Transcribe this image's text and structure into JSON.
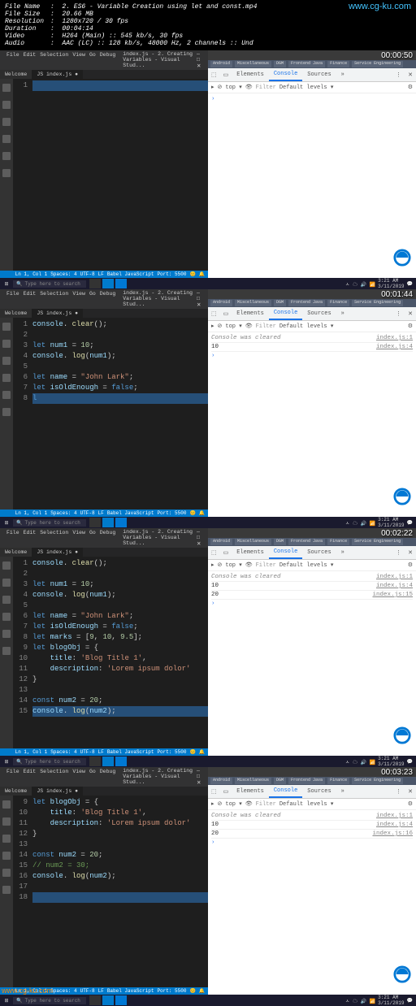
{
  "header": {
    "fileName": "2. ES6 - Variable Creation using let and const.mp4",
    "fileSize": "20.66 MB",
    "resolution": "1280x720 / 30 fps",
    "duration": "00:04:14",
    "video": "H264 (Main) :: 545 kb/s, 30 fps",
    "audio": "AAC (LC) :: 128 kb/s, 48000 Hz, 2 channels :: Und",
    "watermark": "www.cg-ku.com"
  },
  "vscode": {
    "menus": [
      "File",
      "Edit",
      "Selection",
      "View",
      "Go",
      "Debug"
    ],
    "title": "index.js - 2. Creating Variables - Visual Stud...",
    "tab_inactive": "Welcome",
    "tab_active": "index.js",
    "status": {
      "ln": "Ln 1, Col 1",
      "spaces": "Spaces: 4",
      "utf": "UTF-8",
      "lf": "LF",
      "lang": "Babel JavaScript",
      "port": "Port: 5500"
    }
  },
  "devtools": {
    "tabs": [
      "Elements",
      "Console",
      "Sources"
    ],
    "top": "top",
    "filter": "Filter",
    "levels": "Default levels",
    "cleared": "Console was cleared",
    "src1": "index.js:1",
    "src4": "index.js:4",
    "src15": "index.js:15",
    "src16": "index.js:16",
    "val10": "10",
    "val20": "20"
  },
  "taskbar": {
    "search": "Type here to search",
    "time": "3:21 AM",
    "date": "3/11/2019"
  },
  "bookmarks": [
    "Android",
    "Miscellaneous",
    "DGM",
    "Frontend Java",
    "Finance",
    "Service Engineering"
  ],
  "panels": [
    {
      "timer": "00:00:50",
      "code": [
        {
          "n": "1",
          "html": ""
        }
      ],
      "sel_line": 1,
      "console": []
    },
    {
      "timer": "00:01:44",
      "code": [
        {
          "n": "1",
          "tokens": [
            [
              "var",
              "console"
            ],
            [
              "",
              ". "
            ],
            [
              "fn",
              "clear"
            ],
            [
              "",
              "();"
            ]
          ]
        },
        {
          "n": "2",
          "tokens": []
        },
        {
          "n": "3",
          "tokens": [
            [
              "type",
              "let "
            ],
            [
              "var",
              "num1"
            ],
            [
              "",
              " = "
            ],
            [
              "num",
              "10"
            ],
            [
              "",
              ";"
            ]
          ]
        },
        {
          "n": "4",
          "tokens": [
            [
              "var",
              "console"
            ],
            [
              "",
              ". "
            ],
            [
              "fn",
              "log"
            ],
            [
              "",
              "("
            ],
            [
              "var",
              "num1"
            ],
            [
              "",
              ");"
            ]
          ]
        },
        {
          "n": "5",
          "tokens": []
        },
        {
          "n": "6",
          "tokens": [
            [
              "type",
              "let "
            ],
            [
              "var",
              "name"
            ],
            [
              "",
              " = "
            ],
            [
              "str",
              "\"John Lark\""
            ],
            [
              "",
              ";"
            ]
          ]
        },
        {
          "n": "7",
          "tokens": [
            [
              "type",
              "let "
            ],
            [
              "var",
              "isOldEnough"
            ],
            [
              "",
              " = "
            ],
            [
              "type",
              "false"
            ],
            [
              "",
              ";"
            ]
          ]
        },
        {
          "n": "8",
          "tokens": [
            [
              "type",
              "l"
            ]
          ]
        }
      ],
      "sel_line": 8,
      "console": [
        {
          "msg": "Console was cleared",
          "italic": true,
          "src": "index.js:1"
        },
        {
          "msg": "10",
          "src": "index.js:4"
        }
      ]
    },
    {
      "timer": "00:02:22",
      "code": [
        {
          "n": "1",
          "tokens": [
            [
              "var",
              "console"
            ],
            [
              "",
              ". "
            ],
            [
              "fn",
              "clear"
            ],
            [
              "",
              "();"
            ]
          ]
        },
        {
          "n": "2",
          "tokens": []
        },
        {
          "n": "3",
          "tokens": [
            [
              "type",
              "let "
            ],
            [
              "var",
              "num1"
            ],
            [
              "",
              " = "
            ],
            [
              "num",
              "10"
            ],
            [
              "",
              ";"
            ]
          ]
        },
        {
          "n": "4",
          "tokens": [
            [
              "var",
              "console"
            ],
            [
              "",
              ". "
            ],
            [
              "fn",
              "log"
            ],
            [
              "",
              "("
            ],
            [
              "var",
              "num1"
            ],
            [
              "",
              ");"
            ]
          ]
        },
        {
          "n": "5",
          "tokens": []
        },
        {
          "n": "6",
          "tokens": [
            [
              "type",
              "let "
            ],
            [
              "var",
              "name"
            ],
            [
              "",
              " = "
            ],
            [
              "str",
              "\"John Lark\""
            ],
            [
              "",
              ";"
            ]
          ]
        },
        {
          "n": "7",
          "tokens": [
            [
              "type",
              "let "
            ],
            [
              "var",
              "isOldEnough"
            ],
            [
              "",
              " = "
            ],
            [
              "type",
              "false"
            ],
            [
              "",
              ";"
            ]
          ]
        },
        {
          "n": "8",
          "tokens": [
            [
              "type",
              "let "
            ],
            [
              "var",
              "marks"
            ],
            [
              "",
              " = ["
            ],
            [
              "num",
              "9"
            ],
            [
              "",
              ", "
            ],
            [
              "num",
              "10"
            ],
            [
              "",
              ", "
            ],
            [
              "num",
              "9.5"
            ],
            [
              "",
              "];"
            ]
          ]
        },
        {
          "n": "9",
          "tokens": [
            [
              "type",
              "let "
            ],
            [
              "var",
              "blogObj"
            ],
            [
              "",
              " = {"
            ]
          ]
        },
        {
          "n": "10",
          "tokens": [
            [
              "",
              "    "
            ],
            [
              "var",
              "title"
            ],
            [
              "",
              ": "
            ],
            [
              "str",
              "'Blog Title 1'"
            ],
            [
              "",
              ","
            ]
          ]
        },
        {
          "n": "11",
          "tokens": [
            [
              "",
              "    "
            ],
            [
              "var",
              "description"
            ],
            [
              "",
              ": "
            ],
            [
              "str",
              "'Lorem ipsum dolor'"
            ]
          ]
        },
        {
          "n": "12",
          "tokens": [
            [
              "",
              "}"
            ]
          ]
        },
        {
          "n": "13",
          "tokens": []
        },
        {
          "n": "14",
          "tokens": [
            [
              "type",
              "const "
            ],
            [
              "var",
              "num2"
            ],
            [
              "",
              " = "
            ],
            [
              "num",
              "20"
            ],
            [
              "",
              ";"
            ]
          ]
        },
        {
          "n": "15",
          "tokens": [
            [
              "var",
              "console"
            ],
            [
              "",
              ". "
            ],
            [
              "fn",
              "log"
            ],
            [
              "",
              "("
            ],
            [
              "var",
              "num2"
            ],
            [
              "",
              ");"
            ]
          ]
        }
      ],
      "sel_line": 15,
      "console": [
        {
          "msg": "Console was cleared",
          "italic": true,
          "src": "index.js:1"
        },
        {
          "msg": "10",
          "src": "index.js:4"
        },
        {
          "msg": "20",
          "src": "index.js:15"
        }
      ]
    },
    {
      "timer": "00:03:23",
      "code": [
        {
          "n": "9",
          "tokens": [
            [
              "type",
              "let "
            ],
            [
              "var",
              "blogObj"
            ],
            [
              "",
              " = {"
            ]
          ]
        },
        {
          "n": "10",
          "tokens": [
            [
              "",
              "    "
            ],
            [
              "var",
              "title"
            ],
            [
              "",
              ": "
            ],
            [
              "str",
              "'Blog Title 1'"
            ],
            [
              "",
              ","
            ]
          ]
        },
        {
          "n": "11",
          "tokens": [
            [
              "",
              "    "
            ],
            [
              "var",
              "description"
            ],
            [
              "",
              ": "
            ],
            [
              "str",
              "'Lorem ipsum dolor'"
            ]
          ]
        },
        {
          "n": "12",
          "tokens": [
            [
              "",
              "}"
            ]
          ]
        },
        {
          "n": "13",
          "tokens": []
        },
        {
          "n": "14",
          "tokens": [
            [
              "type",
              "const "
            ],
            [
              "var",
              "num2"
            ],
            [
              "",
              " = "
            ],
            [
              "num",
              "20"
            ],
            [
              "",
              ";"
            ]
          ]
        },
        {
          "n": "15",
          "tokens": [
            [
              "cmt",
              "// num2 = 30;"
            ]
          ]
        },
        {
          "n": "16",
          "tokens": [
            [
              "var",
              "console"
            ],
            [
              "",
              ". "
            ],
            [
              "fn",
              "log"
            ],
            [
              "",
              "("
            ],
            [
              "var",
              "num2"
            ],
            [
              "",
              ");"
            ]
          ]
        },
        {
          "n": "17",
          "tokens": []
        },
        {
          "n": "18",
          "tokens": []
        }
      ],
      "sel_line": 18,
      "console": [
        {
          "msg": "Console was cleared",
          "italic": true,
          "src": "index.js:1"
        },
        {
          "msg": "10",
          "src": "index.js:4"
        },
        {
          "msg": "20",
          "src": "index.js:16"
        }
      ],
      "bottom_watermark": "www.cg-ku.com"
    }
  ]
}
